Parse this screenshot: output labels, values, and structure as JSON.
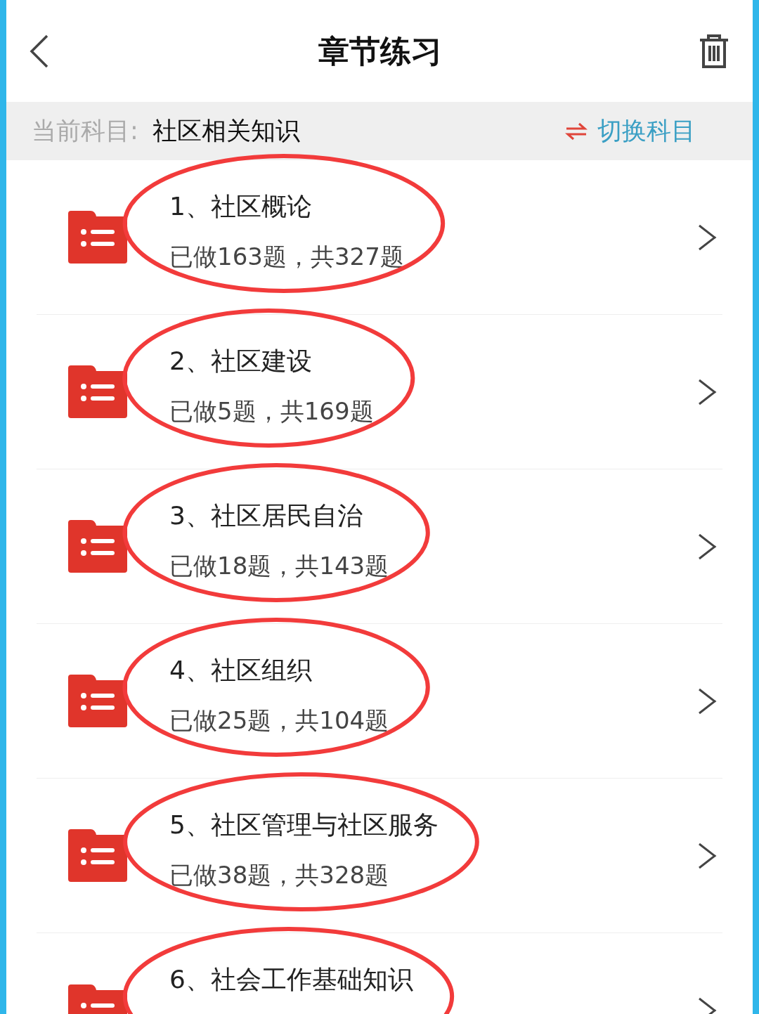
{
  "header": {
    "title": "章节练习"
  },
  "subject_bar": {
    "label": "当前科目:",
    "subject": "社区相关知识",
    "switch_label": "切换科目"
  },
  "chapters": [
    {
      "title": "1、社区概论",
      "progress": "已做163题，共327题",
      "circled": true
    },
    {
      "title": "2、社区建设",
      "progress": "已做5题，共169题",
      "circled": true
    },
    {
      "title": "3、社区居民自治",
      "progress": "已做18题，共143题",
      "circled": true
    },
    {
      "title": "4、社区组织",
      "progress": "已做25题，共104题",
      "circled": true
    },
    {
      "title": "5、社区管理与社区服务",
      "progress": "已做38题，共328题",
      "circled": true
    },
    {
      "title": "6、社会工作基础知识",
      "circled": true
    }
  ]
}
